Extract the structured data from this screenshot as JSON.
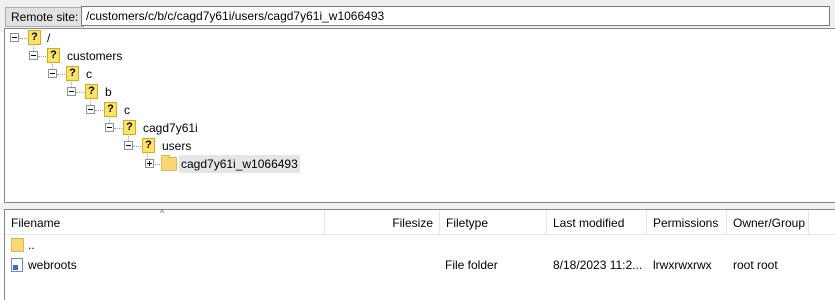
{
  "remote_site": {
    "label": "Remote site:",
    "path": "/customers/c/b/c/cagd7y61i/users/cagd7y61i_w1066493"
  },
  "tree": {
    "nodes": [
      {
        "label": "/"
      },
      {
        "label": "customers"
      },
      {
        "label": "c"
      },
      {
        "label": "b"
      },
      {
        "label": "c"
      },
      {
        "label": "cagd7y61i"
      },
      {
        "label": "users"
      },
      {
        "label": "cagd7y61i_w1066493",
        "selected": true
      }
    ]
  },
  "file_list": {
    "columns": [
      "Filename",
      "Filesize",
      "Filetype",
      "Last modified",
      "Permissions",
      "Owner/Group"
    ],
    "rows": [
      {
        "filename": "..",
        "filesize": "",
        "filetype": "",
        "last_modified": "",
        "permissions": "",
        "owner_group": ""
      },
      {
        "filename": "webroots",
        "filesize": "",
        "filetype": "File folder",
        "last_modified": "8/18/2023 11:2...",
        "permissions": "lrwxrwxrwx",
        "owner_group": "root root"
      }
    ]
  }
}
